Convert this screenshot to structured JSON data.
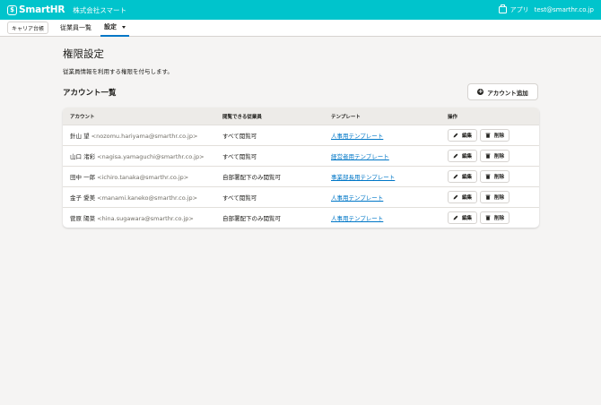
{
  "header": {
    "logo_text": "SmartHR",
    "company": "株式会社スマート",
    "apps_label": "アプリ",
    "user_email": "test@smarthr.co.jp"
  },
  "subnav": {
    "career_button": "キャリア台帳",
    "employees": "従業員一覧",
    "settings": "設定"
  },
  "page": {
    "title": "権限設定",
    "description": "従業員情報を利用する権限を付与します。",
    "section_title": "アカウント一覧",
    "add_button": "アカウント追加"
  },
  "table": {
    "headers": [
      "アカウント",
      "閲覧できる従業員",
      "テンプレート",
      "操作"
    ],
    "edit_label": "編集",
    "delete_label": "削除",
    "rows": [
      {
        "name": "針山 望",
        "email": "<nozomu.hariyama@smarthr.co.jp>",
        "scope": "すべて閲覧可",
        "template": "人事用テンプレート"
      },
      {
        "name": "山口 渚彩",
        "email": "<nagisa.yamaguchi@smarthr.co.jp>",
        "scope": "すべて閲覧可",
        "template": "経営者用テンプレート"
      },
      {
        "name": "田中 一郎",
        "email": "<ichiro.tanaka@smarthr.co.jp>",
        "scope": "自部署配下のみ閲覧可",
        "template": "事業部長用テンプレート"
      },
      {
        "name": "金子 愛美",
        "email": "<manami.kaneko@smarthr.co.jp>",
        "scope": "すべて閲覧可",
        "template": "人事用テンプレート"
      },
      {
        "name": "菅原 陽菜",
        "email": "<hina.sugawara@smarthr.co.jp>",
        "scope": "自部署配下のみ閲覧可",
        "template": "人事用テンプレート"
      }
    ]
  },
  "colors": {
    "brand": "#00c4cc",
    "link": "#0077c7",
    "background": "#f5f4f3"
  }
}
